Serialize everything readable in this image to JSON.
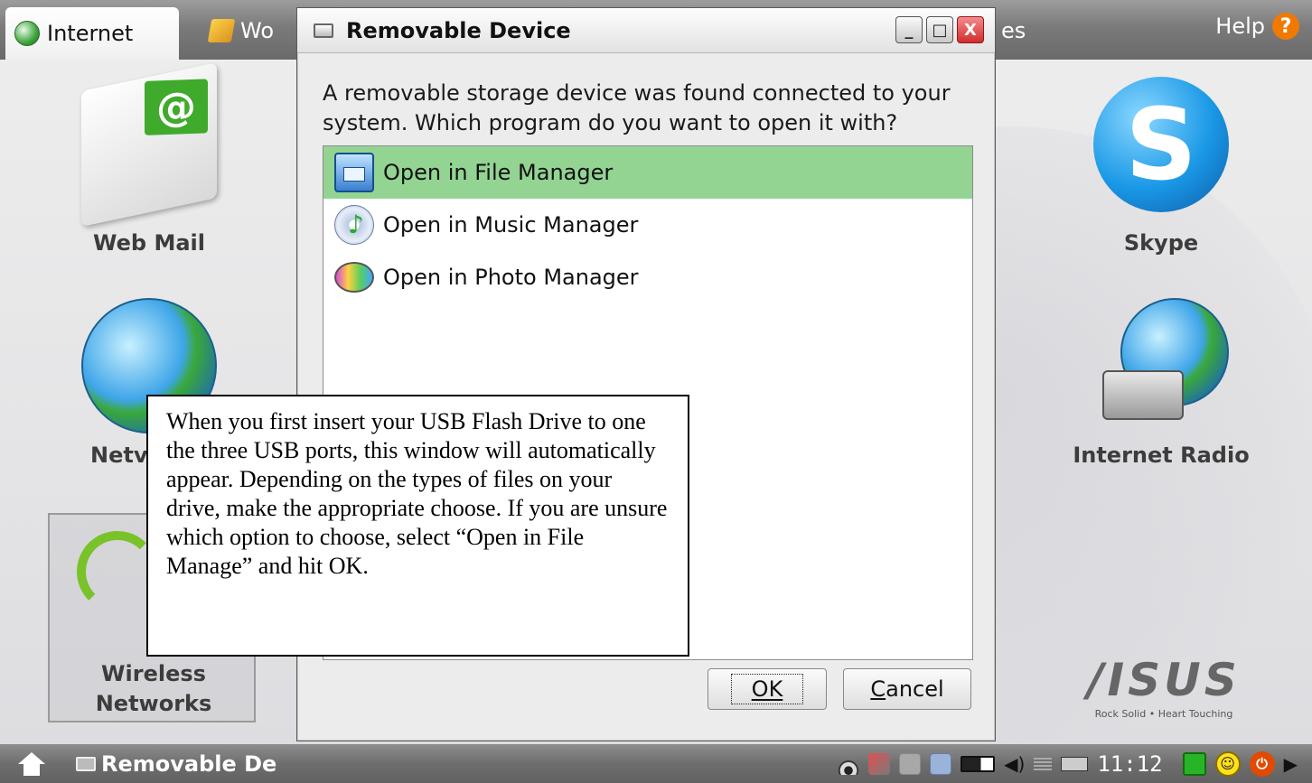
{
  "topbar": {
    "tabs": [
      {
        "label": "Internet",
        "icon": "globe-icon"
      },
      {
        "label": "Wo",
        "icon": "work-icon"
      },
      {
        "label": "es",
        "icon": ""
      }
    ],
    "help_label": "Help",
    "help_icon": "?"
  },
  "desktop": {
    "apps": [
      {
        "label": "Web Mail",
        "icon": "mail-icon"
      },
      {
        "label": "Netv",
        "icon": "network-globe-icon"
      },
      {
        "label": "Wireless",
        "label2": "Networks",
        "icon": "wireless-icon"
      },
      {
        "label": "Skype",
        "icon": "skype-icon",
        "glyph": "S"
      },
      {
        "label": "Internet Radio",
        "icon": "radio-icon"
      }
    ]
  },
  "dialog": {
    "title": "Removable Device",
    "window_buttons": [
      "_",
      "□",
      "X"
    ],
    "prompt": "A removable storage device was found connected to your system. Which program do you want to open it with?",
    "options": [
      {
        "label": "Open in File Manager",
        "icon": "file-manager-icon",
        "selected": true
      },
      {
        "label": "Open in Music Manager",
        "icon": "music-manager-icon",
        "selected": false
      },
      {
        "label": "Open in Photo Manager",
        "icon": "photo-manager-icon",
        "selected": false
      }
    ],
    "ok_label": "OK",
    "cancel_label": "Cancel"
  },
  "callout": {
    "text": "When you first insert your USB Flash Drive to one the three USB ports, this window will automatically appear. Depending on the types of files on your drive, make the appropriate choose.  If you are unsure which option to choose, select “Open in File Manage” and hit OK."
  },
  "brand": {
    "logo": "/ISUS",
    "tagline": "Rock Solid • Heart Touching"
  },
  "taskbar": {
    "task_label": "Removable De",
    "clock": "11:12"
  },
  "colors": {
    "selection": "#93d493",
    "topbar": "#7a7a7a",
    "close_button": "#d42c2c"
  }
}
